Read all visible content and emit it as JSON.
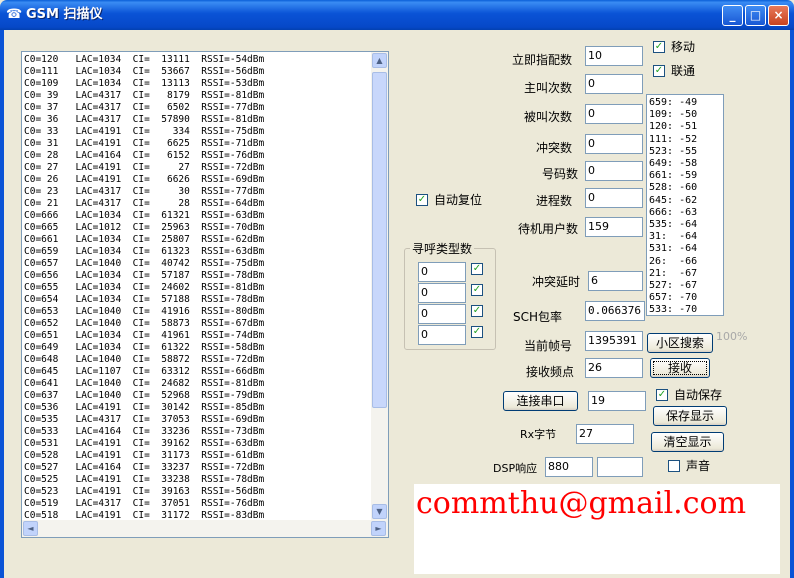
{
  "window": {
    "title": "GSM 扫描仪",
    "app_icon": "gsm-app-icon"
  },
  "title_buttons": {
    "minimize": "_",
    "maximize": "□",
    "close": "×"
  },
  "cell_list": [
    "C0=120   LAC=1034  CI=  13111  RSSI=-54dBm",
    "C0=111   LAC=1034  CI=  53667  RSSI=-56dBm",
    "C0=109   LAC=1034  CI=  13113  RSSI=-53dBm",
    "C0= 39   LAC=4317  CI=   8179  RSSI=-81dBm",
    "C0= 37   LAC=4317  CI=   6502  RSSI=-77dBm",
    "C0= 36   LAC=4317  CI=  57890  RSSI=-81dBm",
    "C0= 33   LAC=4191  CI=    334  RSSI=-75dBm",
    "C0= 31   LAC=4191  CI=   6625  RSSI=-71dBm",
    "C0= 28   LAC=4164  CI=   6152  RSSI=-76dBm",
    "C0= 27   LAC=4191  CI=     27  RSSI=-72dBm",
    "C0= 26   LAC=4191  CI=   6626  RSSI=-69dBm",
    "C0= 23   LAC=4317  CI=     30  RSSI=-77dBm",
    "C0= 21   LAC=4317  CI=     28  RSSI=-64dBm",
    "C0=666   LAC=1034  CI=  61321  RSSI=-63dBm",
    "C0=665   LAC=1012  CI=  25963  RSSI=-70dBm",
    "C0=661   LAC=1034  CI=  25807  RSSI=-62dBm",
    "C0=659   LAC=1034  CI=  61323  RSSI=-63dBm",
    "C0=657   LAC=1040  CI=  40742  RSSI=-75dBm",
    "C0=656   LAC=1034  CI=  57187  RSSI=-78dBm",
    "C0=655   LAC=1034  CI=  24602  RSSI=-81dBm",
    "C0=654   LAC=1034  CI=  57188  RSSI=-78dBm",
    "C0=653   LAC=1040  CI=  41916  RSSI=-80dBm",
    "C0=652   LAC=1040  CI=  58873  RSSI=-67dBm",
    "C0=651   LAC=1034  CI=  41961  RSSI=-74dBm",
    "C0=649   LAC=1034  CI=  61322  RSSI=-58dBm",
    "C0=648   LAC=1040  CI=  58872  RSSI=-72dBm",
    "C0=645   LAC=1107  CI=  63312  RSSI=-66dBm",
    "C0=641   LAC=1040  CI=  24682  RSSI=-81dBm",
    "C0=637   LAC=1040  CI=  52968  RSSI=-79dBm",
    "C0=536   LAC=4191  CI=  30142  RSSI=-85dBm",
    "C0=535   LAC=4317  CI=  37053  RSSI=-69dBm",
    "C0=533   LAC=4164  CI=  33236  RSSI=-73dBm",
    "C0=531   LAC=4191  CI=  39162  RSSI=-63dBm",
    "C0=528   LAC=4191  CI=  31173  RSSI=-61dBm",
    "C0=527   LAC=4164  CI=  33237  RSSI=-72dBm",
    "C0=525   LAC=4191  CI=  33238  RSSI=-78dBm",
    "C0=523   LAC=4191  CI=  39163  RSSI=-56dBm",
    "C0=519   LAC=4317  CI=  37051  RSSI=-76dBm",
    "C0=518   LAC=4191  CI=  31172  RSSI=-83dBm"
  ],
  "scroll_arrows": {
    "up": "▲",
    "down": "▼",
    "left": "◄",
    "right": "►"
  },
  "auto_reset": {
    "label": "自动复位",
    "checked": true
  },
  "call_type_group": {
    "title": "寻呼类型数",
    "rows": [
      {
        "value": "0",
        "checked": true
      },
      {
        "value": "0",
        "checked": true
      },
      {
        "value": "0",
        "checked": true
      },
      {
        "value": "0",
        "checked": true
      }
    ]
  },
  "stats": {
    "immediate_assign": {
      "label": "立即指配数",
      "value": "10"
    },
    "calling": {
      "label": "主叫次数",
      "value": "0"
    },
    "called": {
      "label": "被叫次数",
      "value": "0"
    },
    "conflict": {
      "label": "冲突数",
      "value": "0"
    },
    "number_count": {
      "label": "号码数",
      "value": "0"
    },
    "process_count": {
      "label": "进程数",
      "value": "0"
    },
    "idle_users": {
      "label": "待机用户数",
      "value": "159"
    },
    "conflict_delay": {
      "label": "冲突延时",
      "value": "6"
    },
    "sch_rate": {
      "label": "SCH包率",
      "value": "0.066376"
    },
    "current_frame": {
      "label": "当前帧号",
      "value": "1395391"
    },
    "rx_freq": {
      "label": "接收频点",
      "value": "26"
    }
  },
  "operators": {
    "mobile": {
      "label": "移动",
      "checked": true
    },
    "unicom": {
      "label": "联通",
      "checked": true
    }
  },
  "rssi_list": [
    "659: -49",
    "109: -50",
    "120: -51",
    "111: -52",
    "523: -55",
    "649: -58",
    "661: -59",
    "528: -60",
    "645: -62",
    "666: -63",
    "535: -64",
    "31:  -64",
    "531: -64",
    "26:  -66",
    "21:  -67",
    "527: -67",
    "657: -70",
    "533: -70"
  ],
  "buttons": {
    "cell_search": "小区搜索",
    "receive": "接收",
    "connect_serial": "连接串口",
    "save_display": "保存显示",
    "clear_display": "清空显示"
  },
  "progress_text": "100%",
  "serial_port": {
    "value": "19"
  },
  "auto_save": {
    "label": "自动保存",
    "checked": true
  },
  "rx_bytes": {
    "label": "Rx字节",
    "value": "27"
  },
  "dsp_response": {
    "label": "DSP响应",
    "value": "880",
    "value2": ""
  },
  "sound": {
    "label": "声音",
    "checked": false
  },
  "email": "commthu@gmail.com",
  "colors": {
    "title_bar": "#0a53d6",
    "dialog_bg": "#ece9d8",
    "email_red": "#ff0000",
    "check_green": "#21a121"
  }
}
